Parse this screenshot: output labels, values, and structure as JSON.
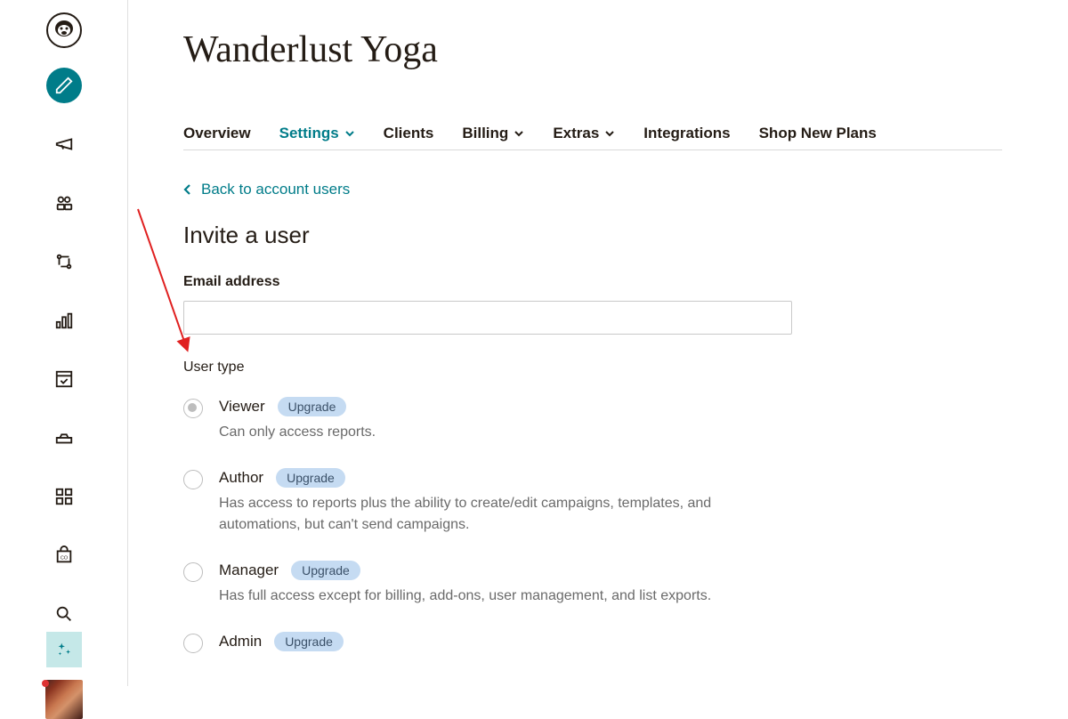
{
  "account_name": "Wanderlust Yoga",
  "tabs": [
    {
      "label": "Overview",
      "has_dropdown": false,
      "active": false
    },
    {
      "label": "Settings",
      "has_dropdown": true,
      "active": true
    },
    {
      "label": "Clients",
      "has_dropdown": false,
      "active": false
    },
    {
      "label": "Billing",
      "has_dropdown": true,
      "active": false
    },
    {
      "label": "Extras",
      "has_dropdown": true,
      "active": false
    },
    {
      "label": "Integrations",
      "has_dropdown": false,
      "active": false
    },
    {
      "label": "Shop New Plans",
      "has_dropdown": false,
      "active": false
    }
  ],
  "back_link": "Back to account users",
  "section_title": "Invite a user",
  "email_label": "Email address",
  "email_value": "",
  "user_type_label": "User type",
  "upgrade_label": "Upgrade",
  "user_types": [
    {
      "name": "Viewer",
      "desc": "Can only access reports.",
      "selected": true
    },
    {
      "name": "Author",
      "desc": "Has access to reports plus the ability to create/edit campaigns, templates, and automations, but can't send campaigns.",
      "selected": false
    },
    {
      "name": "Manager",
      "desc": "Has full access except for billing, add-ons, user management, and list exports.",
      "selected": false
    },
    {
      "name": "Admin",
      "desc": "",
      "selected": false
    }
  ],
  "sidebar_icons": [
    "logo",
    "create",
    "campaigns",
    "audience",
    "automations",
    "analytics",
    "content",
    "website",
    "apps",
    "commerce",
    "search"
  ]
}
